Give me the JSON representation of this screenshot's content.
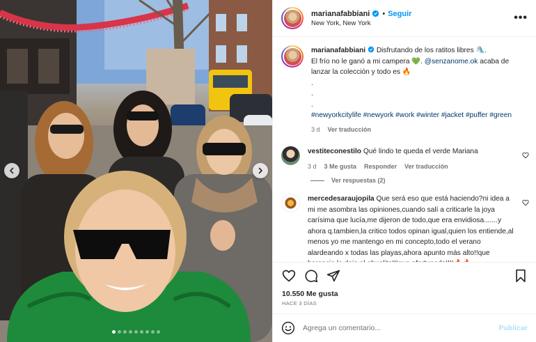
{
  "post": {
    "username": "marianafabbiani",
    "follow_label": "Seguir",
    "separator": "•",
    "location": "New York, New York",
    "more_label": "•••",
    "caption_lines": [
      " Disfrutando de los ratitos libres 🛝.",
      "El frío no le ganó a mi campera 💚. ",
      " acaba de lanzar la colección y todo es 🔥"
    ],
    "caption_mention": "@senzanome.ok",
    "caption_dots": ".",
    "hashtags": "#newyorkcitylife #newyork #work #winter #jacket #puffer #green",
    "time": "3 d",
    "see_translation": "Ver traducción"
  },
  "comments": [
    {
      "username": "vestiteconestilo",
      "text": " Qué lindo te queda el verde Mariana",
      "time": "3 d",
      "likes": "3 Me gusta",
      "reply": "Responder",
      "translate": "Ver traducción",
      "view_replies": "Ver respuestas (2)"
    },
    {
      "username": "mercedesaraujopila",
      "text": " Que será eso que está haciendo?ni idea a mi me asombra las opiniones,cuando salí a criticarle la joya carísima que lucía,me dijeron de todo,que era envidiosa.......y ahora q.tambien,la critico todos opinan igual,quien los entiende,al menos yo me mantengo en mi concepto,todo el verano alardeando x todas las playas,ahora apunto más alto!!que herencia le dejo el abuelito!!!que afortunada!!!!🔥🔥"
    }
  ],
  "footer": {
    "likes": "10.550 Me gusta",
    "ago": "HACE 3 DÍAS",
    "comment_placeholder": "Agrega un comentario...",
    "publish_label": "Publicar"
  },
  "carousel": {
    "total_slides": 9,
    "active_index": 0
  },
  "colors": {
    "accent": "#0095f6",
    "hashtag": "#00376b",
    "muted": "#737373",
    "publish_disabled": "#b2dffc"
  },
  "icons": [
    "verified-badge-icon",
    "more-options-icon",
    "heart-icon",
    "comment-icon",
    "share-icon",
    "bookmark-icon",
    "emoji-icon",
    "chevron-left-icon",
    "chevron-right-icon"
  ]
}
